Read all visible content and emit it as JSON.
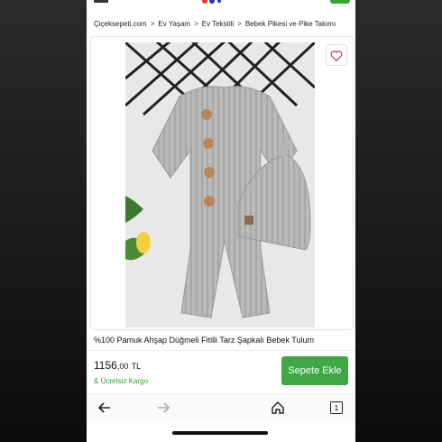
{
  "breadcrumb": {
    "items": [
      "Çiçeksepeti.com",
      "Ev Yaşam",
      "Ev Tekstili",
      "Bebek Pikesi ve Pike Takımı"
    ],
    "separator": ">"
  },
  "product": {
    "title": "%100 Pamuk Ahşap Düğmeli Fitilli Tarz Şapkalı Bebek Tulum",
    "price_main": "1156",
    "price_decimal": ",00",
    "currency": "TL",
    "shipping": "& Ücretsiz Kargo",
    "add_to_cart_label": "Sepete Ekle"
  },
  "bottom_nav": {
    "tab_count": "1"
  },
  "colors": {
    "brand_green": "#3fa845",
    "shipping_green": "#2f9e3a"
  }
}
